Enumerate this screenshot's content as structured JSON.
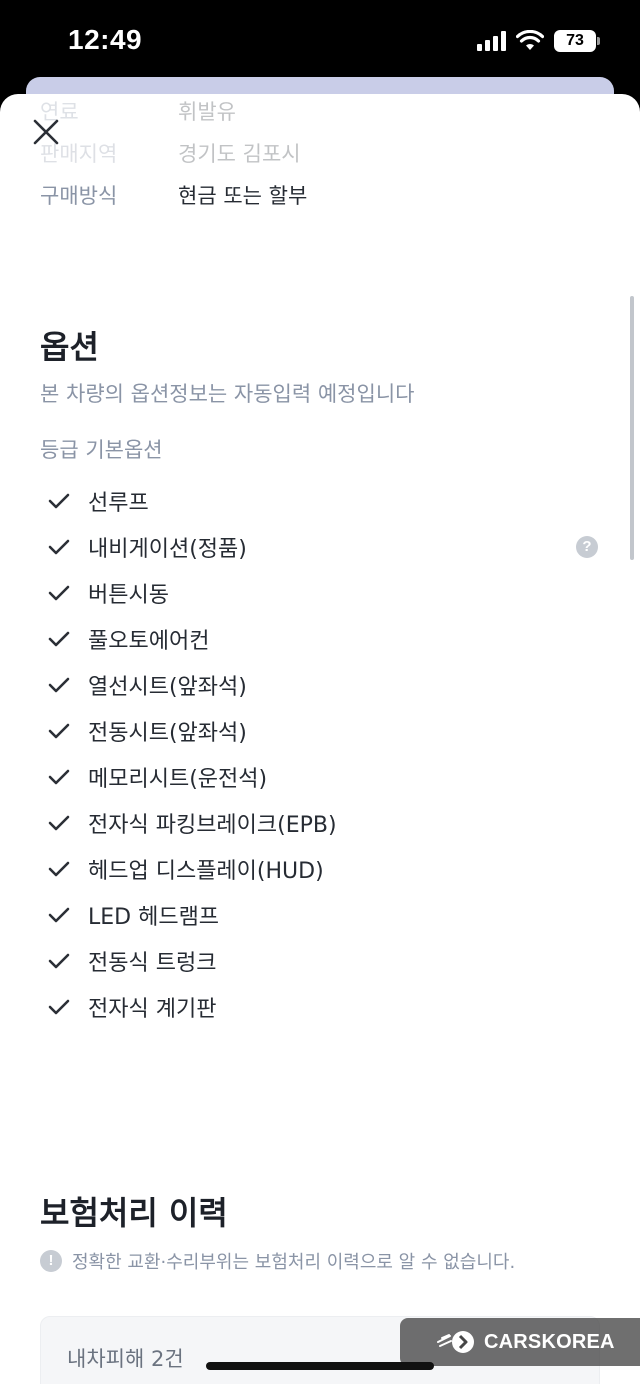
{
  "status_bar": {
    "time": "12:49",
    "battery": "73"
  },
  "basic_info": [
    {
      "label": "연료",
      "value": "휘발유"
    },
    {
      "label": "판매지역",
      "value": "경기도 김포시"
    },
    {
      "label": "구매방식",
      "value": "현금 또는 할부"
    }
  ],
  "options": {
    "title": "옵션",
    "notice": "본 차량의 옵션정보는 자동입력 예정입니다",
    "grade": "등급 기본옵션",
    "items": [
      {
        "label": "선루프",
        "has_help": false
      },
      {
        "label": "내비게이션(정품)",
        "has_help": true
      },
      {
        "label": "버튼시동",
        "has_help": false
      },
      {
        "label": "풀오토에어컨",
        "has_help": false
      },
      {
        "label": "열선시트(앞좌석)",
        "has_help": false
      },
      {
        "label": "전동시트(앞좌석)",
        "has_help": false
      },
      {
        "label": "메모리시트(운전석)",
        "has_help": false
      },
      {
        "label": "전자식 파킹브레이크(EPB)",
        "has_help": false
      },
      {
        "label": "헤드업 디스플레이(HUD)",
        "has_help": false
      },
      {
        "label": "LED 헤드램프",
        "has_help": false
      },
      {
        "label": "전동식 트렁크",
        "has_help": false
      },
      {
        "label": "전자식 계기판",
        "has_help": false
      }
    ]
  },
  "insurance": {
    "title": "보험처리 이력",
    "notice": "정확한 교환·수리부위는 보험처리 이력으로 알 수 없습니다.",
    "damage": "내차피해 2건"
  },
  "watermark": {
    "text": "CARSKOREA"
  },
  "colors": {
    "check": "#2b2f36",
    "muted": "#8a94a6",
    "title": "#1d2129"
  }
}
